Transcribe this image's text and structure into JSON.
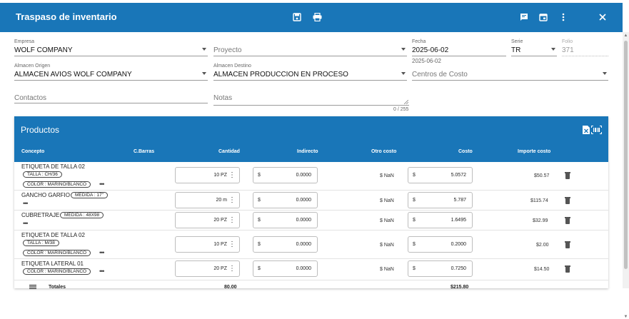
{
  "window": {
    "title": "Traspaso de inventario"
  },
  "header_icons": [
    "save-icon",
    "print-icon",
    "comment-icon",
    "calendar-icon",
    "more-vert-icon",
    "close-icon"
  ],
  "form": {
    "empresa": {
      "label": "Empresa",
      "value": "WOLF COMPANY"
    },
    "proyecto": {
      "placeholder": "Proyecto"
    },
    "fecha": {
      "label": "Fecha",
      "value": "2025-06-02",
      "hint": "2025-06-02"
    },
    "serie": {
      "label": "Serie",
      "value": "TR"
    },
    "folio": {
      "label": "Folio",
      "value": "371"
    },
    "almacen_origen": {
      "label": "Almacen Origen",
      "value": "ALMACEN AVIOS WOLF COMPANY"
    },
    "almacen_destino": {
      "label": "Almacen Destino",
      "value": "ALMACEN PRODUCCION EN PROCESO"
    },
    "centros_costo": {
      "placeholder": "Centros de Costo"
    },
    "contactos": {
      "placeholder": "Contactos"
    },
    "notas": {
      "placeholder": "Notas",
      "counter": "0 / 255"
    }
  },
  "products": {
    "title": "Productos",
    "columns": {
      "concepto": "Concepto",
      "cbarras": "C.Barras",
      "cantidad": "Cantidad",
      "indirecto": "Indirecto",
      "otro_costo": "Otro costo",
      "costo": "Costo",
      "importe": "Importe costo"
    },
    "rows": [
      {
        "name": "ETIQUETA DE TALLA 02",
        "chip1": "TALLA : CH/36",
        "chip2": "COLOR : MARINO/BLANCO",
        "qty": "10 PZ",
        "currency": "$",
        "indirecto": "0.0000",
        "otro": "$ NaN",
        "costo": "5.0572",
        "importe": "$50.57"
      },
      {
        "name": "GANCHO GARFIO",
        "chip1": "MEDIDA : 17\"",
        "qty": "20 m",
        "currency": "$",
        "indirecto": "0.0000",
        "otro": "$ NaN",
        "costo": "5.787",
        "importe": "$115.74"
      },
      {
        "name": "CUBRETRAJE",
        "chip1": "MEDIDA : 48X98",
        "qty": "20 PZ",
        "currency": "$",
        "indirecto": "0.0000",
        "otro": "$ NaN",
        "costo": "1.6495",
        "importe": "$32.99"
      },
      {
        "name": "ETIQUETA DE TALLA 02",
        "chip1": "TALLA : M/38",
        "chip2": "COLOR : MARINO/BLANCO",
        "qty": "10 PZ",
        "currency": "$",
        "indirecto": "0.0000",
        "otro": "$ NaN",
        "costo": "0.2000",
        "importe": "$2.00"
      },
      {
        "name": "ETIQUETA LATERAL 01",
        "chip1": "COLOR : MARINO/BLANCO",
        "qty": "20 PZ",
        "currency": "$",
        "indirecto": "0.0000",
        "otro": "$ NaN",
        "costo": "0.7250",
        "importe": "$14.50"
      }
    ],
    "totals": {
      "label": "Totales",
      "cantidad": "80.00",
      "costo": "$215.80"
    },
    "more_glyph": "•••"
  }
}
